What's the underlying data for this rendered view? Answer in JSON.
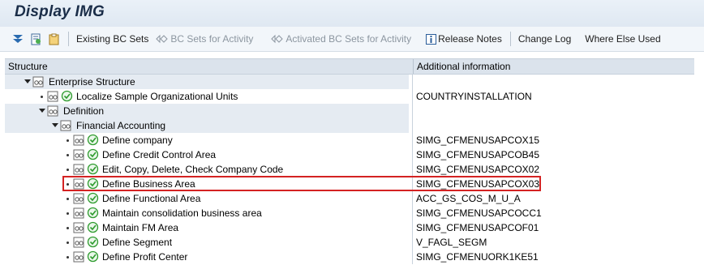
{
  "window": {
    "title": "Display IMG"
  },
  "toolbar": {
    "icons": [
      "filter-icon",
      "find-icon",
      "clipboard-icon"
    ],
    "buttons": [
      {
        "label": "Existing BC Sets",
        "enabled": true,
        "icon": ""
      },
      {
        "label": "BC Sets for Activity",
        "enabled": false,
        "icon": "bcset-icon"
      },
      {
        "label": "Activated BC Sets for Activity",
        "enabled": false,
        "icon": "bcset-icon"
      },
      {
        "label": "Release Notes",
        "enabled": true,
        "icon": "info-icon"
      },
      {
        "label": "Change Log",
        "enabled": true,
        "icon": ""
      },
      {
        "label": "Where Else Used",
        "enabled": true,
        "icon": ""
      }
    ]
  },
  "tree": {
    "columns": [
      "Structure",
      "Additional information"
    ],
    "rows": [
      {
        "label": "Enterprise Structure",
        "info": "",
        "level": 0,
        "node": "expanded",
        "executable": false
      },
      {
        "label": "Localize Sample Organizational Units",
        "info": "COUNTRYINSTALLATION",
        "level": 1,
        "node": "leaf",
        "executable": true
      },
      {
        "label": "Definition",
        "info": "",
        "level": 1,
        "node": "expanded",
        "executable": false
      },
      {
        "label": "Financial Accounting",
        "info": "",
        "level": 2,
        "node": "expanded",
        "executable": false
      },
      {
        "label": "Define company",
        "info": "SIMG_CFMENUSAPCOX15",
        "level": 3,
        "node": "leaf",
        "executable": true
      },
      {
        "label": "Define Credit Control Area",
        "info": "SIMG_CFMENUSAPCOB45",
        "level": 3,
        "node": "leaf",
        "executable": true
      },
      {
        "label": "Edit, Copy, Delete, Check Company Code",
        "info": "SIMG_CFMENUSAPCOX02",
        "level": 3,
        "node": "leaf",
        "executable": true
      },
      {
        "label": "Define Business Area",
        "info": "SIMG_CFMENUSAPCOX03",
        "level": 3,
        "node": "leaf",
        "executable": true,
        "highlighted": true
      },
      {
        "label": "Define Functional Area",
        "info": "ACC_GS_COS_M_U_A",
        "level": 3,
        "node": "leaf",
        "executable": true
      },
      {
        "label": "Maintain consolidation business area",
        "info": "SIMG_CFMENUSAPCOCC1",
        "level": 3,
        "node": "leaf",
        "executable": true
      },
      {
        "label": "Maintain FM Area",
        "info": "SIMG_CFMENUSAPCOF01",
        "level": 3,
        "node": "leaf",
        "executable": true
      },
      {
        "label": "Define Segment",
        "info": "V_FAGL_SEGM",
        "level": 3,
        "node": "leaf",
        "executable": true
      },
      {
        "label": "Define Profit Center",
        "info": "SIMG_CFMENUORK1KE51",
        "level": 3,
        "node": "leaf",
        "executable": true
      }
    ]
  },
  "colors": {
    "highlight": "#d42222",
    "header": "#dbe3ec",
    "accent": "#1a2d48",
    "exec": "#2e9b2e"
  }
}
